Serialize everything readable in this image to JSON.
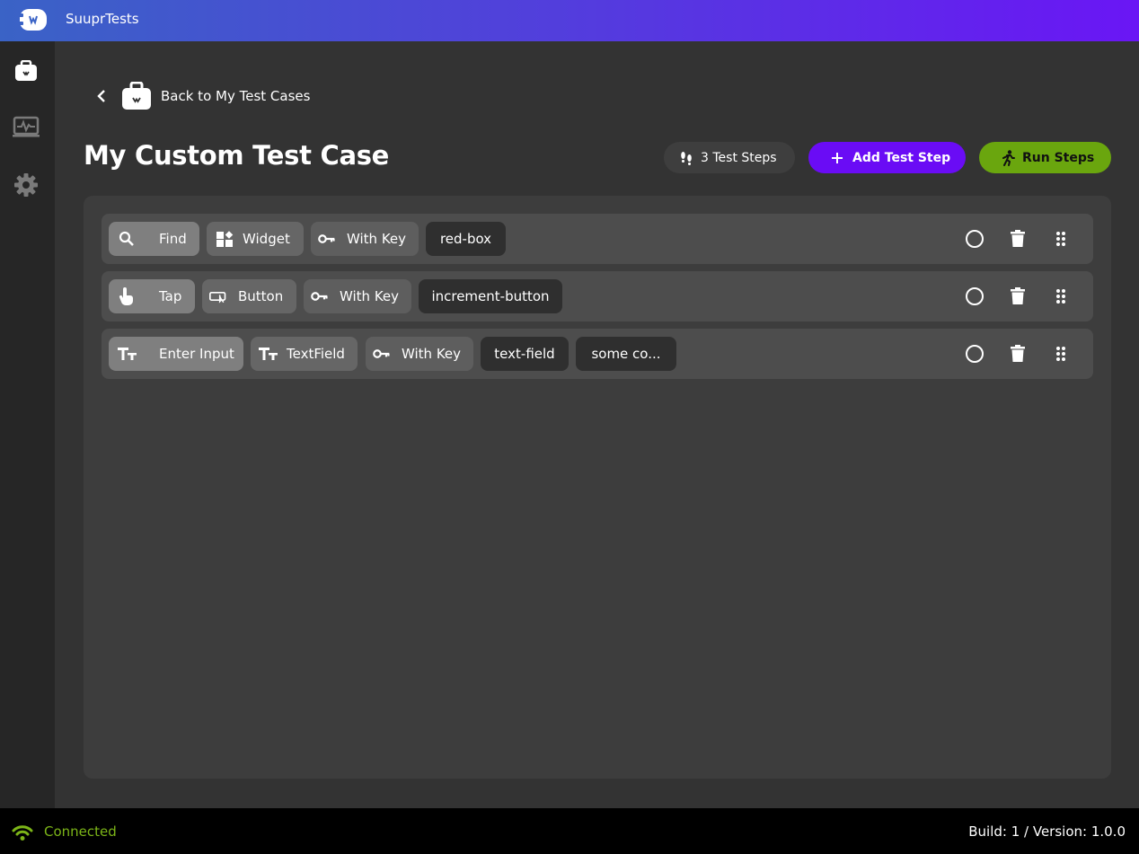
{
  "app": {
    "title": "SuuprTests"
  },
  "sidebar": {
    "items": [
      {
        "icon": "briefcase-icon",
        "active": true
      },
      {
        "icon": "monitor-heart-icon",
        "active": false
      },
      {
        "icon": "gear-icon",
        "active": false
      }
    ]
  },
  "header": {
    "back_label": "Back to My Test Cases",
    "title": "My Custom Test Case",
    "steps_count_label": "3 Test Steps",
    "add_step_label": "Add Test Step",
    "run_steps_label": "Run Steps"
  },
  "steps": [
    {
      "action": "Find",
      "target": "Widget",
      "matcher": "With Key",
      "values": [
        "red-box"
      ]
    },
    {
      "action": "Tap",
      "target": "Button",
      "matcher": "With Key",
      "values": [
        "increment-button"
      ]
    },
    {
      "action": "Enter Input",
      "target": "TextField",
      "matcher": "With Key",
      "values": [
        "text-field",
        "some co..."
      ]
    }
  ],
  "status": {
    "connection": "Connected",
    "build": "Build: 1 / Version: 1.0.0"
  },
  "colors": {
    "accent_purple": "#6a0cf5",
    "accent_green": "#6aa60e",
    "connected_green": "#7cb518"
  }
}
